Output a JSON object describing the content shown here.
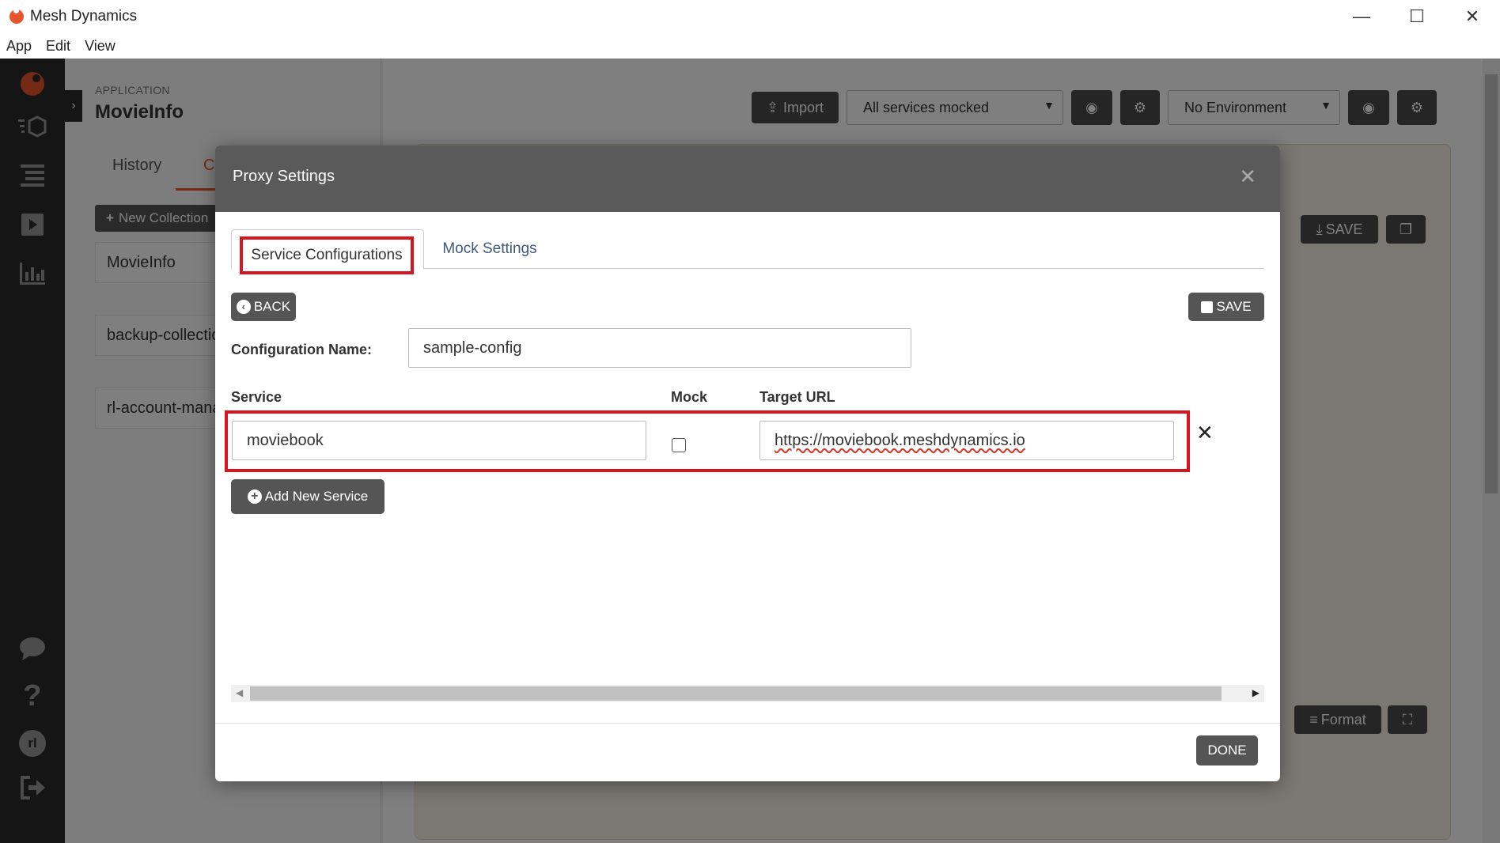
{
  "window": {
    "title": "Mesh Dynamics",
    "controls": {
      "minimize": "—",
      "maximize": "☐",
      "close": "✕"
    }
  },
  "menu": [
    "App",
    "Edit",
    "View"
  ],
  "sidepanel": {
    "application_label": "APPLICATION",
    "application_name": "MovieInfo",
    "tabs": [
      "History",
      "C"
    ],
    "new_collection_label": "New Collection",
    "collections": [
      "MovieInfo",
      "backup-collection",
      "rl-account-manager"
    ]
  },
  "toolbar": {
    "import_label": "Import",
    "mock_select_value": "All services mocked",
    "env_select_value": "No Environment",
    "save_label": "SAVE",
    "format_label": "Format"
  },
  "modal": {
    "title": "Proxy Settings",
    "tabs": {
      "active": "Service Configurations",
      "other": "Mock Settings"
    },
    "back_label": "BACK",
    "save_label": "SAVE",
    "config_name_label": "Configuration Name:",
    "config_name_value": "sample-config",
    "columns": {
      "service": "Service",
      "mock": "Mock",
      "target_url": "Target URL"
    },
    "rows": [
      {
        "service": "moviebook",
        "mock": false,
        "target_url": "https://moviebook.meshdynamics.io"
      }
    ],
    "add_service_label": "Add New Service",
    "done_label": "DONE"
  },
  "user_initials": "rl",
  "colors": {
    "highlight": "#d7141f",
    "dark_button": "#555555",
    "header": "#5a5a5a",
    "sidebar": "#2b2b2b",
    "brand": "#e8542b"
  }
}
